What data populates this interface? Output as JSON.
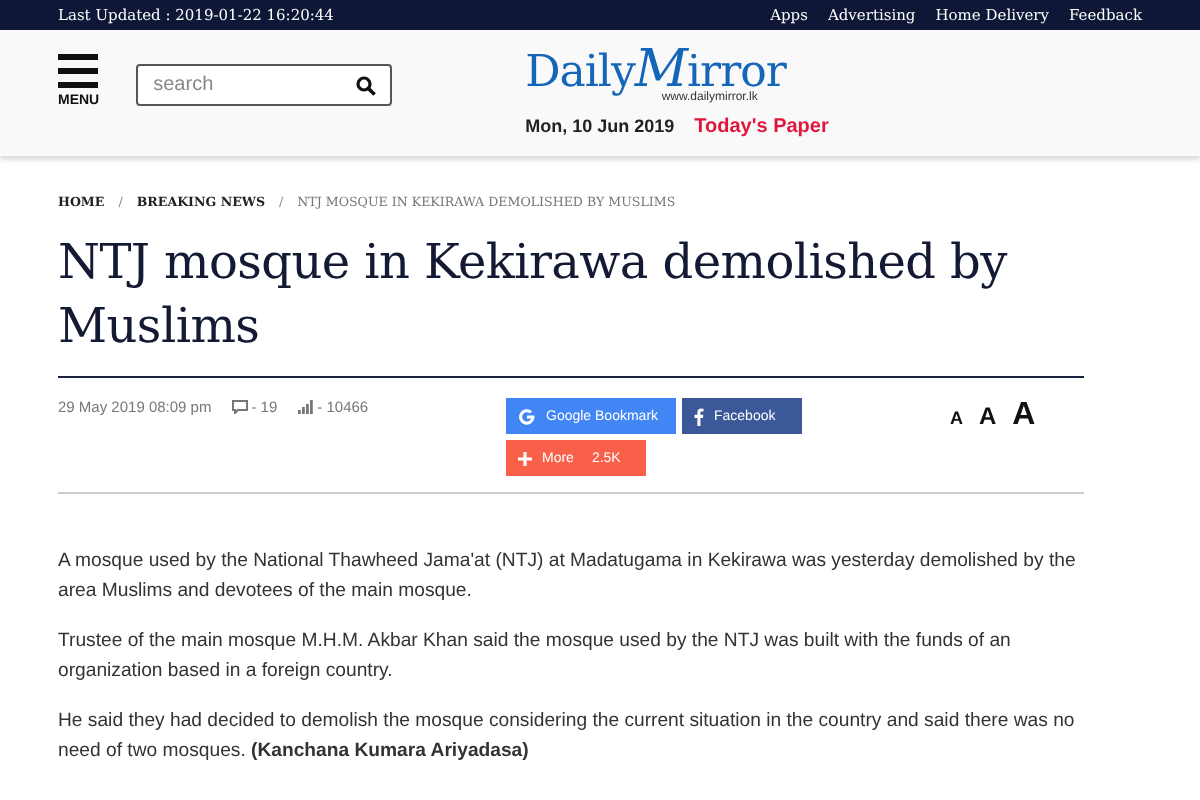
{
  "top_bar": {
    "last_updated": "Last Updated : 2019-01-22 16:20:44",
    "links": [
      "Apps",
      "Advertising",
      "Home Delivery",
      "Feedback"
    ]
  },
  "header": {
    "menu_label": "MENU",
    "search": {
      "placeholder": "search"
    },
    "logo": {
      "name": "DailyMirror",
      "url": "www.dailymirror.lk"
    },
    "date": "Mon, 10 Jun 2019",
    "todays_paper": "Today's Paper"
  },
  "breadcrumb": [
    "HOME",
    "BREAKING NEWS",
    "NTJ MOSQUE IN KEKIRAWA DEMOLISHED BY MUSLIMS"
  ],
  "breadcrumb_separators": [
    "/",
    "/"
  ],
  "article": {
    "title": "NTJ mosque in Kekirawa demolished by Muslims",
    "date": "29 May 2019 08:09 pm",
    "comments": "- 19",
    "views": "- 10466",
    "share_buttons": [
      {
        "kind": "google",
        "label": "Google Bookmark"
      },
      {
        "kind": "facebook",
        "label": "Facebook"
      },
      {
        "kind": "more",
        "label": "More",
        "count": "2.5K"
      }
    ],
    "font_sizes": [
      "A",
      "A",
      "A"
    ],
    "paragraphs": [
      "A mosque used by the National Thawheed Jama'at (NTJ) at Madatugama in Kekirawa was yesterday demolished by the area Muslims and devotees of the main mosque.",
      "Trustee of the main mosque M.H.M. Akbar Khan said the mosque used by the NTJ was built with the funds of an organization based in a foreign country.",
      "He said they had decided to demolish the mosque considering the current situation in the country and said there was no need of two mosques. **(Kanchana Kumara Ariyadasa)**"
    ]
  }
}
